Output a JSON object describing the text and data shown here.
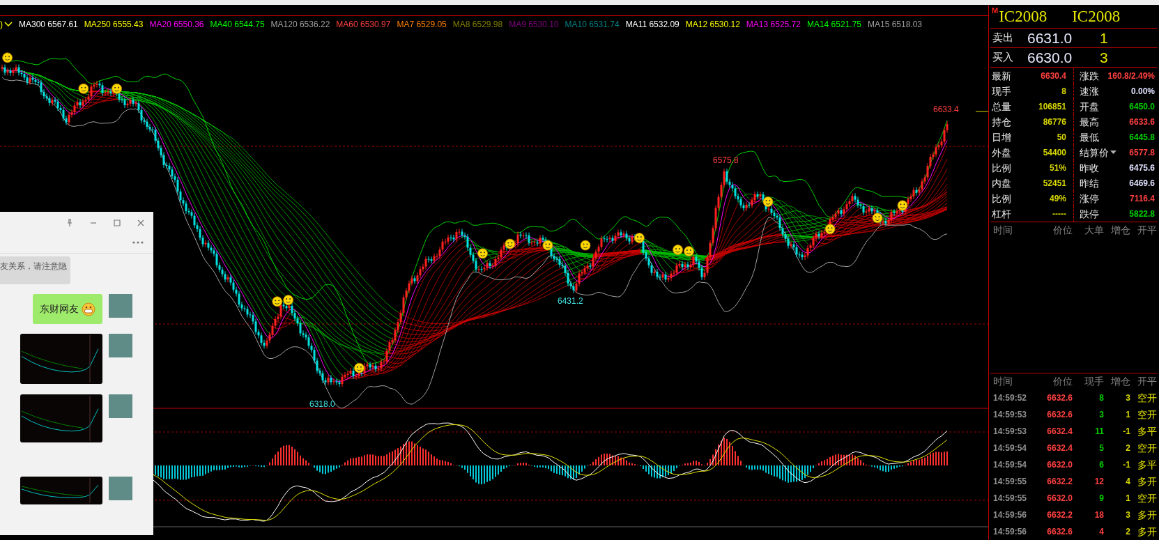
{
  "legend": {
    "prefix": ")",
    "items": [
      {
        "name": "MA300",
        "value": "6567.61",
        "color": "#ffffff"
      },
      {
        "name": "MA250",
        "value": "6555.43",
        "color": "#ffff00"
      },
      {
        "name": "MA20",
        "value": "6550.36",
        "color": "#ff00ff"
      },
      {
        "name": "MA40",
        "value": "6544.75",
        "color": "#00ff00"
      },
      {
        "name": "MA120",
        "value": "6536.22",
        "color": "#a0a0a0"
      },
      {
        "name": "MA60",
        "value": "6530.97",
        "color": "#ff4040"
      },
      {
        "name": "MA7",
        "value": "6529.05",
        "color": "#ff8000"
      },
      {
        "name": "MA8",
        "value": "6529.98",
        "color": "#808000"
      },
      {
        "name": "MA9",
        "value": "6530.10",
        "color": "#800080"
      },
      {
        "name": "MA10",
        "value": "6531.74",
        "color": "#008080"
      },
      {
        "name": "MA11",
        "value": "6532.09",
        "color": "#ffffff"
      },
      {
        "name": "MA12",
        "value": "6530.12",
        "color": "#ffff00"
      },
      {
        "name": "MA13",
        "value": "6525.72",
        "color": "#ff00ff"
      },
      {
        "name": "MA14",
        "value": "6521.75",
        "color": "#00ff00"
      },
      {
        "name": "MA15",
        "value": "6518.03",
        "color": "#a0a0a0"
      }
    ]
  },
  "chart": {
    "price_labels": [
      {
        "text": "6633.4",
        "color": "#ff4040"
      },
      {
        "text": "6575.8",
        "color": "#ff4040"
      },
      {
        "text": "6431.2",
        "color": "#40e0e0"
      },
      {
        "text": "6318.0",
        "color": "#40e0e0"
      }
    ]
  },
  "chat": {
    "system_message": "友关系，请注意隐",
    "messages": [
      {
        "kind": "text",
        "text": "东财网友"
      },
      {
        "kind": "image"
      },
      {
        "kind": "image"
      },
      {
        "kind": "image"
      }
    ]
  },
  "quote": {
    "mark": "M",
    "titles": [
      "IC2008",
      "IC2008"
    ],
    "ask": {
      "label": "卖出",
      "price": "6631.0",
      "volume": "1"
    },
    "bid": {
      "label": "买入",
      "price": "6630.0",
      "volume": "3"
    },
    "stats": [
      {
        "left": {
          "label": "最新",
          "value": "6630.4",
          "color": "#ff4040"
        },
        "right": {
          "label": "涨跌",
          "value": "160.8/2.49%",
          "color": "#ff4040",
          "dropdown": false
        }
      },
      {
        "left": {
          "label": "现手",
          "value": "8",
          "color": "#d8d800"
        },
        "right": {
          "label": "速涨",
          "value": "0.00%",
          "color": "#e0e0ff",
          "dropdown": false
        }
      },
      {
        "left": {
          "label": "总量",
          "value": "106851",
          "color": "#d8d800"
        },
        "right": {
          "label": "开盘",
          "value": "6450.0",
          "color": "#00d000",
          "dropdown": false
        }
      },
      {
        "left": {
          "label": "持仓",
          "value": "86776",
          "color": "#d8d800"
        },
        "right": {
          "label": "最高",
          "value": "6633.6",
          "color": "#ff4040",
          "dropdown": false
        }
      },
      {
        "left": {
          "label": "日增",
          "value": "50",
          "color": "#d8d800"
        },
        "right": {
          "label": "最低",
          "value": "6445.8",
          "color": "#00d000",
          "dropdown": false
        }
      },
      {
        "left": {
          "label": "外盘",
          "value": "54400",
          "color": "#d8d800"
        },
        "right": {
          "label": "结算价",
          "value": "6577.8",
          "color": "#ff4040",
          "dropdown": true
        }
      },
      {
        "left": {
          "label": "比例",
          "value": "51%",
          "color": "#d8d800"
        },
        "right": {
          "label": "昨收",
          "value": "6475.6",
          "color": "#e0e0ff",
          "dropdown": false
        }
      },
      {
        "left": {
          "label": "内盘",
          "value": "52451",
          "color": "#d8d800"
        },
        "right": {
          "label": "昨结",
          "value": "6469.6",
          "color": "#e0e0ff",
          "dropdown": false
        }
      },
      {
        "left": {
          "label": "比例",
          "value": "49%",
          "color": "#d8d800"
        },
        "right": {
          "label": "涨停",
          "value": "7116.4",
          "color": "#ff4040",
          "dropdown": false
        }
      },
      {
        "left": {
          "label": "杠杆",
          "value": "-----",
          "color": "#d8d800"
        },
        "right": {
          "label": "跌停",
          "value": "5822.8",
          "color": "#00d000",
          "dropdown": false
        }
      }
    ],
    "big_order_columns": [
      "时间",
      "价位",
      "大单",
      "增仓",
      "开平"
    ],
    "ticks": {
      "columns": [
        "时间",
        "价位",
        "现手",
        "增仓",
        "开平"
      ],
      "rows": [
        {
          "time": "14:59:52",
          "price": "6632.6",
          "volume": "8",
          "color": "#00d000",
          "change": "3",
          "type": "空开"
        },
        {
          "time": "14:59:53",
          "price": "6632.6",
          "volume": "3",
          "color": "#00d000",
          "change": "1",
          "type": "空开"
        },
        {
          "time": "14:59:53",
          "price": "6632.4",
          "volume": "11",
          "color": "#00d000",
          "change": "-1",
          "type": "多平"
        },
        {
          "time": "14:59:54",
          "price": "6632.4",
          "volume": "5",
          "color": "#00d000",
          "change": "2",
          "type": "空开"
        },
        {
          "time": "14:59:54",
          "price": "6632.0",
          "volume": "6",
          "color": "#00d000",
          "change": "-1",
          "type": "多平"
        },
        {
          "time": "14:59:55",
          "price": "6632.2",
          "volume": "12",
          "color": "#ff4040",
          "change": "4",
          "type": "多开"
        },
        {
          "time": "14:59:55",
          "price": "6632.0",
          "volume": "9",
          "color": "#00d000",
          "change": "1",
          "type": "空开"
        },
        {
          "time": "14:59:56",
          "price": "6632.2",
          "volume": "18",
          "color": "#ff4040",
          "change": "3",
          "type": "多开"
        },
        {
          "time": "14:59:56",
          "price": "6632.6",
          "volume": "4",
          "color": "#ff4040",
          "change": "2",
          "type": "多开"
        }
      ]
    }
  }
}
